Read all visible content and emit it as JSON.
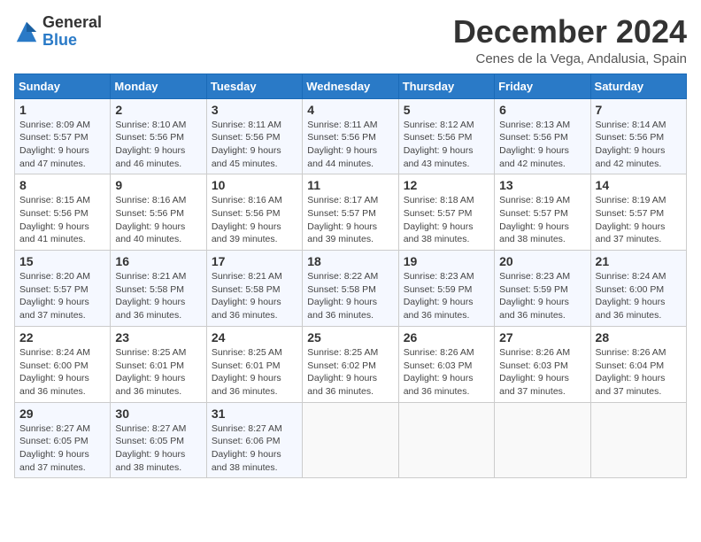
{
  "header": {
    "logo_general": "General",
    "logo_blue": "Blue",
    "title": "December 2024",
    "subtitle": "Cenes de la Vega, Andalusia, Spain"
  },
  "days_of_week": [
    "Sunday",
    "Monday",
    "Tuesday",
    "Wednesday",
    "Thursday",
    "Friday",
    "Saturday"
  ],
  "weeks": [
    [
      {
        "day": "1",
        "sunrise": "8:09 AM",
        "sunset": "5:57 PM",
        "daylight": "9 hours and 47 minutes."
      },
      {
        "day": "2",
        "sunrise": "8:10 AM",
        "sunset": "5:56 PM",
        "daylight": "9 hours and 46 minutes."
      },
      {
        "day": "3",
        "sunrise": "8:11 AM",
        "sunset": "5:56 PM",
        "daylight": "9 hours and 45 minutes."
      },
      {
        "day": "4",
        "sunrise": "8:11 AM",
        "sunset": "5:56 PM",
        "daylight": "9 hours and 44 minutes."
      },
      {
        "day": "5",
        "sunrise": "8:12 AM",
        "sunset": "5:56 PM",
        "daylight": "9 hours and 43 minutes."
      },
      {
        "day": "6",
        "sunrise": "8:13 AM",
        "sunset": "5:56 PM",
        "daylight": "9 hours and 42 minutes."
      },
      {
        "day": "7",
        "sunrise": "8:14 AM",
        "sunset": "5:56 PM",
        "daylight": "9 hours and 42 minutes."
      }
    ],
    [
      {
        "day": "8",
        "sunrise": "8:15 AM",
        "sunset": "5:56 PM",
        "daylight": "9 hours and 41 minutes."
      },
      {
        "day": "9",
        "sunrise": "8:16 AM",
        "sunset": "5:56 PM",
        "daylight": "9 hours and 40 minutes."
      },
      {
        "day": "10",
        "sunrise": "8:16 AM",
        "sunset": "5:56 PM",
        "daylight": "9 hours and 39 minutes."
      },
      {
        "day": "11",
        "sunrise": "8:17 AM",
        "sunset": "5:57 PM",
        "daylight": "9 hours and 39 minutes."
      },
      {
        "day": "12",
        "sunrise": "8:18 AM",
        "sunset": "5:57 PM",
        "daylight": "9 hours and 38 minutes."
      },
      {
        "day": "13",
        "sunrise": "8:19 AM",
        "sunset": "5:57 PM",
        "daylight": "9 hours and 38 minutes."
      },
      {
        "day": "14",
        "sunrise": "8:19 AM",
        "sunset": "5:57 PM",
        "daylight": "9 hours and 37 minutes."
      }
    ],
    [
      {
        "day": "15",
        "sunrise": "8:20 AM",
        "sunset": "5:57 PM",
        "daylight": "9 hours and 37 minutes."
      },
      {
        "day": "16",
        "sunrise": "8:21 AM",
        "sunset": "5:58 PM",
        "daylight": "9 hours and 36 minutes."
      },
      {
        "day": "17",
        "sunrise": "8:21 AM",
        "sunset": "5:58 PM",
        "daylight": "9 hours and 36 minutes."
      },
      {
        "day": "18",
        "sunrise": "8:22 AM",
        "sunset": "5:58 PM",
        "daylight": "9 hours and 36 minutes."
      },
      {
        "day": "19",
        "sunrise": "8:23 AM",
        "sunset": "5:59 PM",
        "daylight": "9 hours and 36 minutes."
      },
      {
        "day": "20",
        "sunrise": "8:23 AM",
        "sunset": "5:59 PM",
        "daylight": "9 hours and 36 minutes."
      },
      {
        "day": "21",
        "sunrise": "8:24 AM",
        "sunset": "6:00 PM",
        "daylight": "9 hours and 36 minutes."
      }
    ],
    [
      {
        "day": "22",
        "sunrise": "8:24 AM",
        "sunset": "6:00 PM",
        "daylight": "9 hours and 36 minutes."
      },
      {
        "day": "23",
        "sunrise": "8:25 AM",
        "sunset": "6:01 PM",
        "daylight": "9 hours and 36 minutes."
      },
      {
        "day": "24",
        "sunrise": "8:25 AM",
        "sunset": "6:01 PM",
        "daylight": "9 hours and 36 minutes."
      },
      {
        "day": "25",
        "sunrise": "8:25 AM",
        "sunset": "6:02 PM",
        "daylight": "9 hours and 36 minutes."
      },
      {
        "day": "26",
        "sunrise": "8:26 AM",
        "sunset": "6:03 PM",
        "daylight": "9 hours and 36 minutes."
      },
      {
        "day": "27",
        "sunrise": "8:26 AM",
        "sunset": "6:03 PM",
        "daylight": "9 hours and 37 minutes."
      },
      {
        "day": "28",
        "sunrise": "8:26 AM",
        "sunset": "6:04 PM",
        "daylight": "9 hours and 37 minutes."
      }
    ],
    [
      {
        "day": "29",
        "sunrise": "8:27 AM",
        "sunset": "6:05 PM",
        "daylight": "9 hours and 37 minutes."
      },
      {
        "day": "30",
        "sunrise": "8:27 AM",
        "sunset": "6:05 PM",
        "daylight": "9 hours and 38 minutes."
      },
      {
        "day": "31",
        "sunrise": "8:27 AM",
        "sunset": "6:06 PM",
        "daylight": "9 hours and 38 minutes."
      },
      null,
      null,
      null,
      null
    ]
  ]
}
